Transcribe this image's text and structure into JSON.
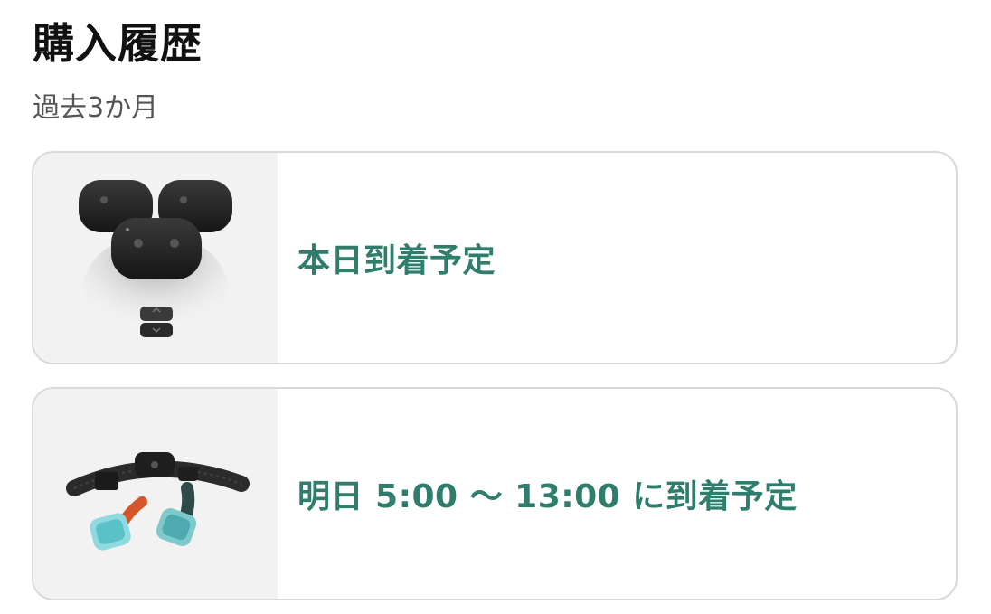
{
  "header": {
    "title": "購入履歴",
    "subtitle": "過去3か月"
  },
  "orders": [
    {
      "product_image": "vive-ultimate-tracker-image",
      "status": "本日到着予定"
    },
    {
      "product_image": "fbt-belt-tracker-image",
      "status": "明日 5:00 〜 13:00 に到着予定"
    }
  ],
  "colors": {
    "status_text": "#2f7d6d",
    "card_border": "#d9d9d9",
    "thumb_background": "#f2f2f2"
  }
}
